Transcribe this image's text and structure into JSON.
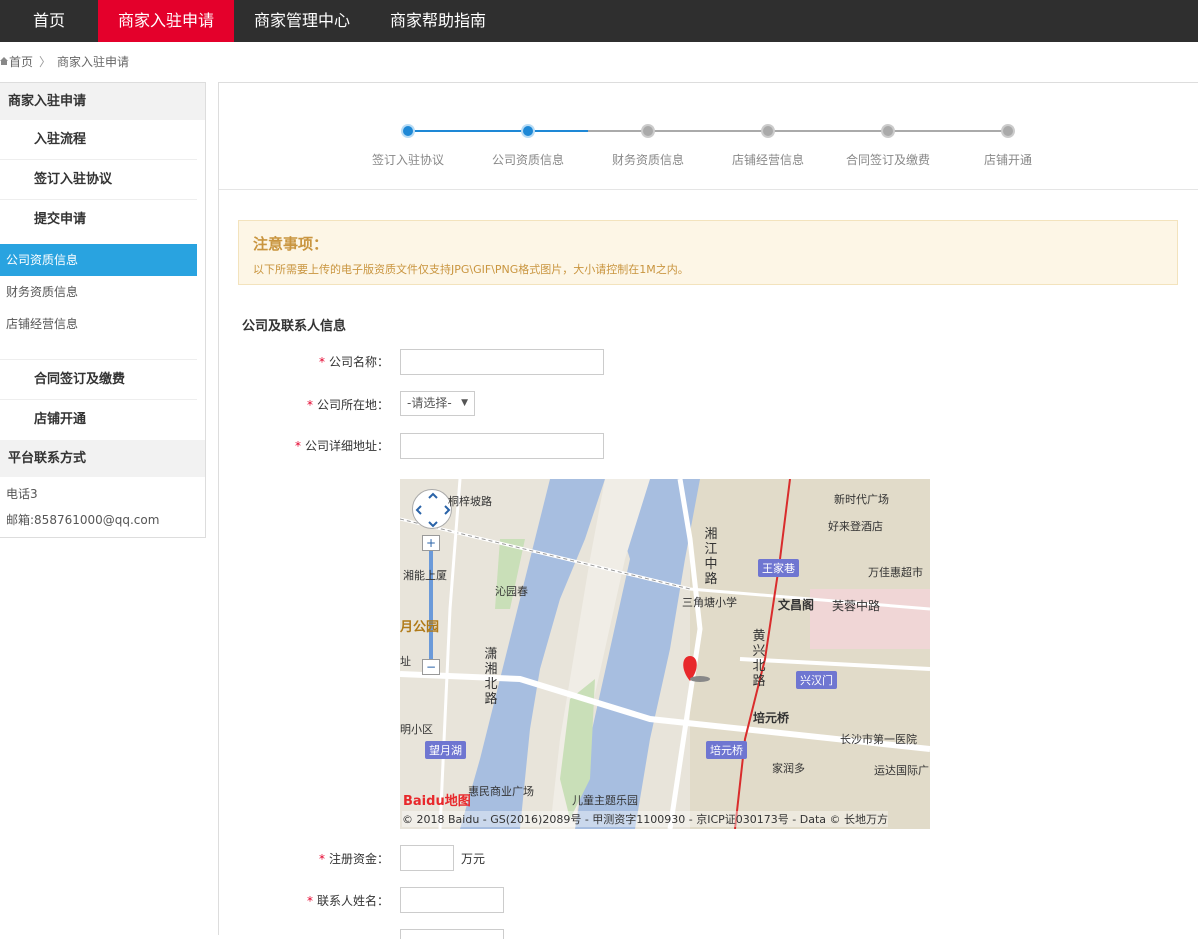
{
  "nav": {
    "items": [
      {
        "label": "首页"
      },
      {
        "label": "商家入驻申请"
      },
      {
        "label": "商家管理中心"
      },
      {
        "label": "商家帮助指南"
      }
    ]
  },
  "breadcrumb": {
    "home": "首页",
    "current": "商家入驻申请"
  },
  "sidebar": {
    "head1": "商家入驻申请",
    "items": [
      "入驻流程",
      "签订入驻协议",
      "提交申请"
    ],
    "subitems": [
      "公司资质信息",
      "财务资质信息",
      "店铺经营信息"
    ],
    "items2": [
      "合同签订及缴费",
      "店铺开通"
    ],
    "head2": "平台联系方式",
    "phone": "电话3",
    "email": "邮箱:858761000@qq.com"
  },
  "steps": [
    "签订入驻协议",
    "公司资质信息",
    "财务资质信息",
    "店铺经营信息",
    "合同签订及缴费",
    "店铺开通"
  ],
  "notice": {
    "title": "注意事项：",
    "text": "以下所需要上传的电子版资质文件仅支持JPG\\GIF\\PNG格式图片，大小请控制在1M之内。"
  },
  "form": {
    "section_title": "公司及联系人信息",
    "company_name_label": "公司名称：",
    "company_location_label": "公司所在地：",
    "company_location_value": "-请选择-",
    "company_address_label": "公司详细地址：",
    "capital_label": "注册资金：",
    "capital_unit": "万元",
    "contact_name_label": "联系人姓名："
  },
  "map": {
    "labels": {
      "tongzi": "桐梓坡路",
      "yuanchun": "沁园春",
      "shangye": "湘能上厦",
      "xinshidai": "新时代广场",
      "haolai": "好来登酒店",
      "wanjia": "万佳惠超市",
      "sanjiao": "三角塘小学",
      "wenchang": "文昌阁",
      "furong": "芙蓉中路",
      "peiyuan": "培元桥",
      "hospital": "长沙市第一医院",
      "jiarun": "家润多",
      "yunda": "运达国际广",
      "ertong": "儿童主题乐园",
      "huimin": "惠民商业广场",
      "mingxiao": "明小区",
      "gongyuan": "月公园",
      "zhi": "址"
    },
    "badges": {
      "wangjia": "王家巷",
      "xinghan": "兴汉门",
      "wangyue": "望月湖",
      "peiyuan": "培元桥"
    },
    "vertical": {
      "xiangjiang": "湘江中路",
      "huangxing": "黄兴北路",
      "xiaoxiang": "潇湘北路"
    },
    "logo": "Baidu地图",
    "copyright": "© 2018 Baidu - GS(2016)2089号 - 甲测资字1100930 - 京ICP证030173号 - Data © 长地万方"
  }
}
